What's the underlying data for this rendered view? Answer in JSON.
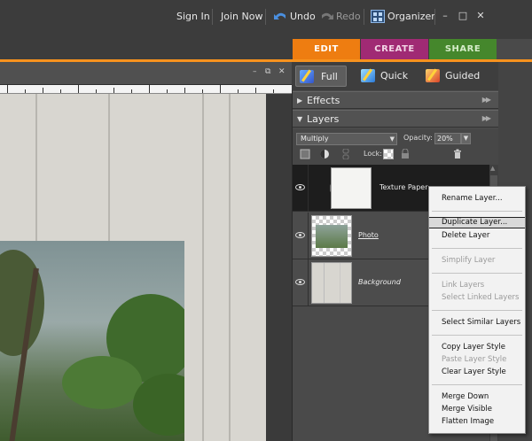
{
  "topbar": {
    "sign_in": "Sign In",
    "join_now": "Join Now",
    "undo": "Undo",
    "redo": "Redo",
    "organizer": "Organizer",
    "minimize": "–",
    "maximize": "□",
    "close": "✕"
  },
  "tabs": [
    {
      "label": "EDIT",
      "color": "#ee7d11",
      "active": true
    },
    {
      "label": "CREATE",
      "color": "#a02a74",
      "active": false
    },
    {
      "label": "SHARE",
      "color": "#45872c",
      "active": false
    }
  ],
  "document": {
    "controls": {
      "minimize": "–",
      "restore": "⧉",
      "close": "✕"
    }
  },
  "modes": [
    {
      "label": "Full",
      "active": true
    },
    {
      "label": "Quick",
      "active": false
    },
    {
      "label": "Guided",
      "active": false
    }
  ],
  "panels": {
    "effects": {
      "label": "Effects",
      "expanded": false
    },
    "layers": {
      "label": "Layers",
      "expanded": true
    }
  },
  "layers_toolbar": {
    "blend_mode": "Multiply",
    "opacity_label": "Opacity:",
    "opacity_value": "20%",
    "lock_label": "Lock:"
  },
  "layers": [
    {
      "name": "Texture Paper",
      "selected": true,
      "visible": true
    },
    {
      "name": "Photo",
      "selected": false,
      "visible": true
    },
    {
      "name": "Background",
      "selected": false,
      "visible": true
    }
  ],
  "context_menu": {
    "items": [
      {
        "label": "Rename Layer...",
        "enabled": true
      },
      {
        "label": "Duplicate Layer...",
        "enabled": true,
        "highlighted": true
      },
      {
        "label": "Delete Layer",
        "enabled": true
      },
      {
        "label": "Simplify Layer",
        "enabled": false
      },
      {
        "label": "Link Layers",
        "enabled": false
      },
      {
        "label": "Select Linked Layers",
        "enabled": false
      },
      {
        "label": "Select Similar Layers",
        "enabled": true
      },
      {
        "label": "Copy Layer Style",
        "enabled": true
      },
      {
        "label": "Paste Layer Style",
        "enabled": false
      },
      {
        "label": "Clear Layer Style",
        "enabled": true
      },
      {
        "label": "Merge Down",
        "enabled": true
      },
      {
        "label": "Merge Visible",
        "enabled": true
      },
      {
        "label": "Flatten Image",
        "enabled": true
      }
    ]
  },
  "colors": {
    "edit_tab": "#ee7d11",
    "create_tab": "#a02a74",
    "share_tab": "#45872c",
    "accent_line": "#f7921e"
  }
}
